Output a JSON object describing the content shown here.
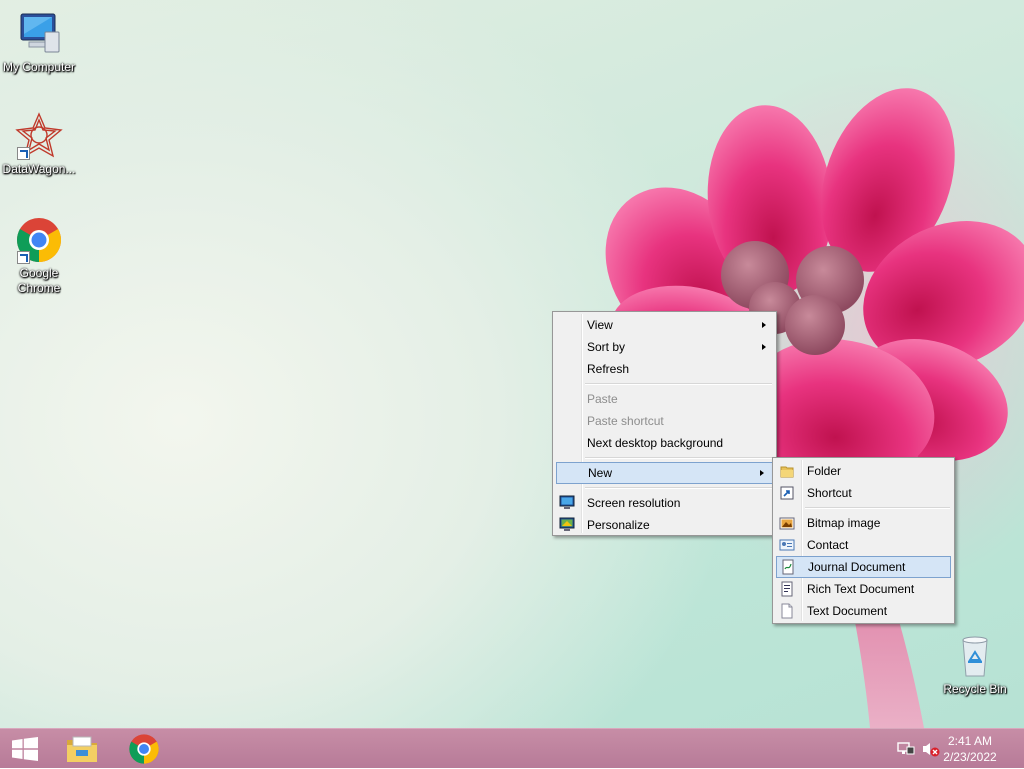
{
  "desktop": {
    "icons": [
      {
        "label": "My Computer",
        "icon": "computer-icon"
      },
      {
        "label": "DataWagon...",
        "icon": "datawagon-icon"
      },
      {
        "label": "Google Chrome",
        "icon": "chrome-icon"
      },
      {
        "label": "Recycle Bin",
        "icon": "recycle-bin-icon"
      }
    ]
  },
  "context_menu": {
    "items": [
      {
        "label": "View",
        "submenu": true
      },
      {
        "label": "Sort by",
        "submenu": true
      },
      {
        "label": "Refresh"
      },
      {
        "label": "Paste",
        "disabled": true
      },
      {
        "label": "Paste shortcut",
        "disabled": true
      },
      {
        "label": "Next desktop background"
      },
      {
        "label": "New",
        "submenu": true,
        "highlighted": true
      },
      {
        "label": "Screen resolution",
        "icon": "screen-resolution-icon"
      },
      {
        "label": "Personalize",
        "icon": "personalize-icon"
      }
    ]
  },
  "new_submenu": {
    "items": [
      {
        "label": "Folder",
        "icon": "folder-icon"
      },
      {
        "label": "Shortcut",
        "icon": "shortcut-icon"
      },
      {
        "label": "Bitmap image",
        "icon": "bitmap-icon"
      },
      {
        "label": "Contact",
        "icon": "contact-icon"
      },
      {
        "label": "Journal Document",
        "icon": "journal-icon",
        "highlighted": true
      },
      {
        "label": "Rich Text Document",
        "icon": "rtf-icon"
      },
      {
        "label": "Text Document",
        "icon": "text-document-icon"
      }
    ]
  },
  "taskbar": {
    "clock": {
      "time": "2:41 AM",
      "date": "2/23/2022"
    },
    "pinned": [
      "file-explorer-icon",
      "chrome-icon"
    ],
    "tray": [
      "network-icon",
      "volume-muted-icon"
    ]
  },
  "colors": {
    "taskbar": "#c08aa3",
    "menu_bg": "#f0f0f0",
    "highlight": "#d5e5f6",
    "flower": "#e8337f"
  }
}
